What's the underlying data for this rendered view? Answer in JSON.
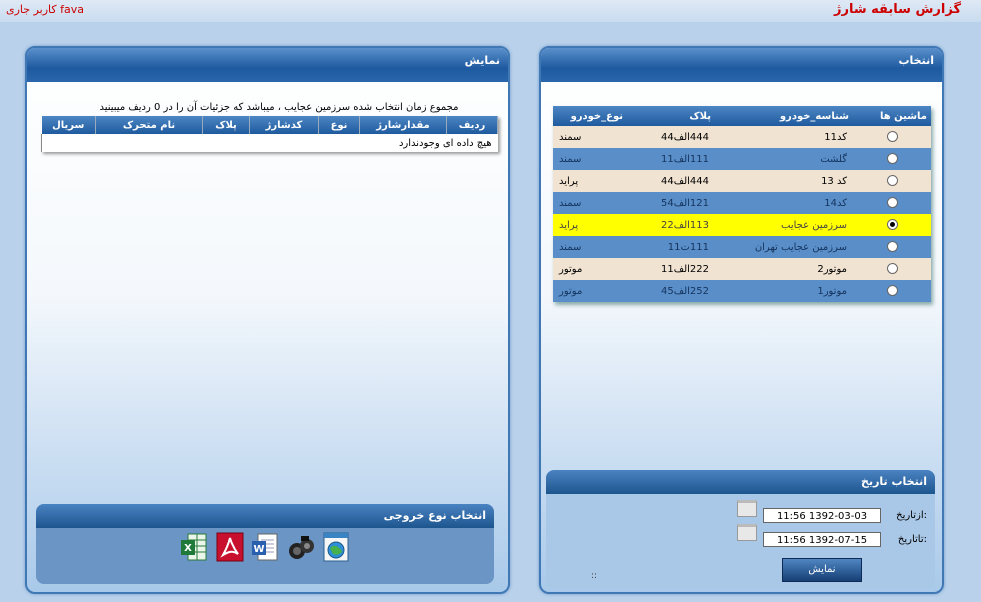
{
  "header": {
    "title": "گزارش سابقه شارژ",
    "user": "کاربر جاری fava"
  },
  "selection_panel": {
    "title": "انتخاب",
    "columns": [
      "ماشین ها",
      "شناسه_خودرو",
      "پلاک",
      "نوع_خودرو"
    ],
    "rows": [
      {
        "vehicle_id": "کد11",
        "plate": "444الف44",
        "type": "سمند",
        "selected": false
      },
      {
        "vehicle_id": "گلشت",
        "plate": "111الف11",
        "type": "سمند",
        "selected": false
      },
      {
        "vehicle_id": "کد 13",
        "plate": "444الف44",
        "type": "پراید",
        "selected": false
      },
      {
        "vehicle_id": "کد14",
        "plate": "121الف54",
        "type": "سمند",
        "selected": false
      },
      {
        "vehicle_id": "سرزمین عجایب",
        "plate": "113الف22",
        "type": "پراید",
        "selected": true
      },
      {
        "vehicle_id": "سرزمین عجایب تهران",
        "plate": "111ت11",
        "type": "سمند",
        "selected": false
      },
      {
        "vehicle_id": "موتور2",
        "plate": "222الف11",
        "type": "موتور",
        "selected": false
      },
      {
        "vehicle_id": "موتور1",
        "plate": "252الف45",
        "type": "موتور",
        "selected": false
      }
    ]
  },
  "date_panel": {
    "title": "انتخاب تاریخ",
    "from_label": "ازتاریخ:",
    "from_value": "11:56 1392-03-03",
    "to_label": "تاتاریخ:",
    "to_value": "11:56 1392-07-15",
    "show_button": "نمایش",
    "dots": "::"
  },
  "display_panel": {
    "title": "نمایش",
    "summary": "مجموع زمان انتخاب شده سرزمین عجایب ، میباشد که جزئیات آن را در 0 ردیف میبینید",
    "columns": [
      "ردیف",
      "مقدارشارژ",
      "نوع",
      "کدشارژ",
      "پلاک",
      "نام متحرک",
      "سریال"
    ],
    "empty_message": "هیچ داده ای وجودندارد"
  },
  "export_panel": {
    "title": "انتخاب نوع خروجی",
    "icons": [
      "excel-icon",
      "pdf-icon",
      "word-icon",
      "camera-icon",
      "web-icon"
    ]
  }
}
